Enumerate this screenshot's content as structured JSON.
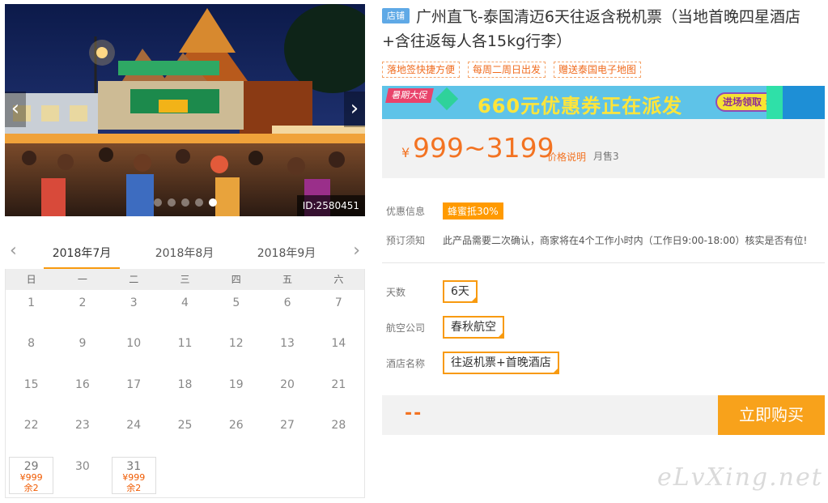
{
  "gallery": {
    "photo_id": "ID:2580451",
    "prev_arrow": "‹",
    "next_arrow": "›",
    "slides": 5,
    "active_slide": 4
  },
  "calendar": {
    "prev_arrow": "‹",
    "next_arrow": "›",
    "months": [
      "2018年7月",
      "2018年8月",
      "2018年9月"
    ],
    "active_month": 0,
    "weekdays": [
      "日",
      "一",
      "二",
      "三",
      "四",
      "五",
      "六"
    ],
    "days": [
      {
        "d": "1"
      },
      {
        "d": "2"
      },
      {
        "d": "3"
      },
      {
        "d": "4"
      },
      {
        "d": "5"
      },
      {
        "d": "6"
      },
      {
        "d": "7"
      },
      {
        "d": "8"
      },
      {
        "d": "9"
      },
      {
        "d": "10"
      },
      {
        "d": "11"
      },
      {
        "d": "12"
      },
      {
        "d": "13"
      },
      {
        "d": "14"
      },
      {
        "d": "15"
      },
      {
        "d": "16"
      },
      {
        "d": "17"
      },
      {
        "d": "18"
      },
      {
        "d": "19"
      },
      {
        "d": "20"
      },
      {
        "d": "21"
      },
      {
        "d": "22"
      },
      {
        "d": "23"
      },
      {
        "d": "24"
      },
      {
        "d": "25"
      },
      {
        "d": "26"
      },
      {
        "d": "27"
      },
      {
        "d": "28"
      },
      {
        "d": "29",
        "price": "¥999",
        "left": "余2"
      },
      {
        "d": "30"
      },
      {
        "d": "31",
        "price": "¥999",
        "left": "余2"
      }
    ]
  },
  "product": {
    "shop_tag": "店铺",
    "title": "广州直飞-泰国清迈6天往返含税机票（当地首晚四星酒店+含往返每人各15kg行李）",
    "tags": [
      "落地签快捷方便",
      "每周二周日出发",
      "赠送泰国电子地图"
    ]
  },
  "banner": {
    "label": "暑期大促",
    "text": "660元优惠券正在派发",
    "button": "进场领取 »"
  },
  "price": {
    "currency": "¥",
    "range": "999~3199",
    "explain": "价格说明",
    "sold": "月售3"
  },
  "info": {
    "discount_label": "优惠信息",
    "discount_badge": "蜂蜜抵30%",
    "notice_label": "预订须知",
    "notice_text": "此产品需要二次确认，商家将在4个工作小时内（工作日9:00-18:00）核实是否有位!"
  },
  "options": {
    "days_label": "天数",
    "days_value": "6天",
    "airline_label": "航空公司",
    "airline_value": "春秋航空",
    "hotel_label": "酒店名称",
    "hotel_value": "往返机票+首晚酒店"
  },
  "buy": {
    "total": "--",
    "button": "立即购买"
  },
  "watermark": "eLvXing.net",
  "colors": {
    "accent_orange": "#f89a0f",
    "price_orange": "#f37322",
    "banner_blue": "#5ec3e8",
    "shop_tag_blue": "#5fa9e6"
  }
}
